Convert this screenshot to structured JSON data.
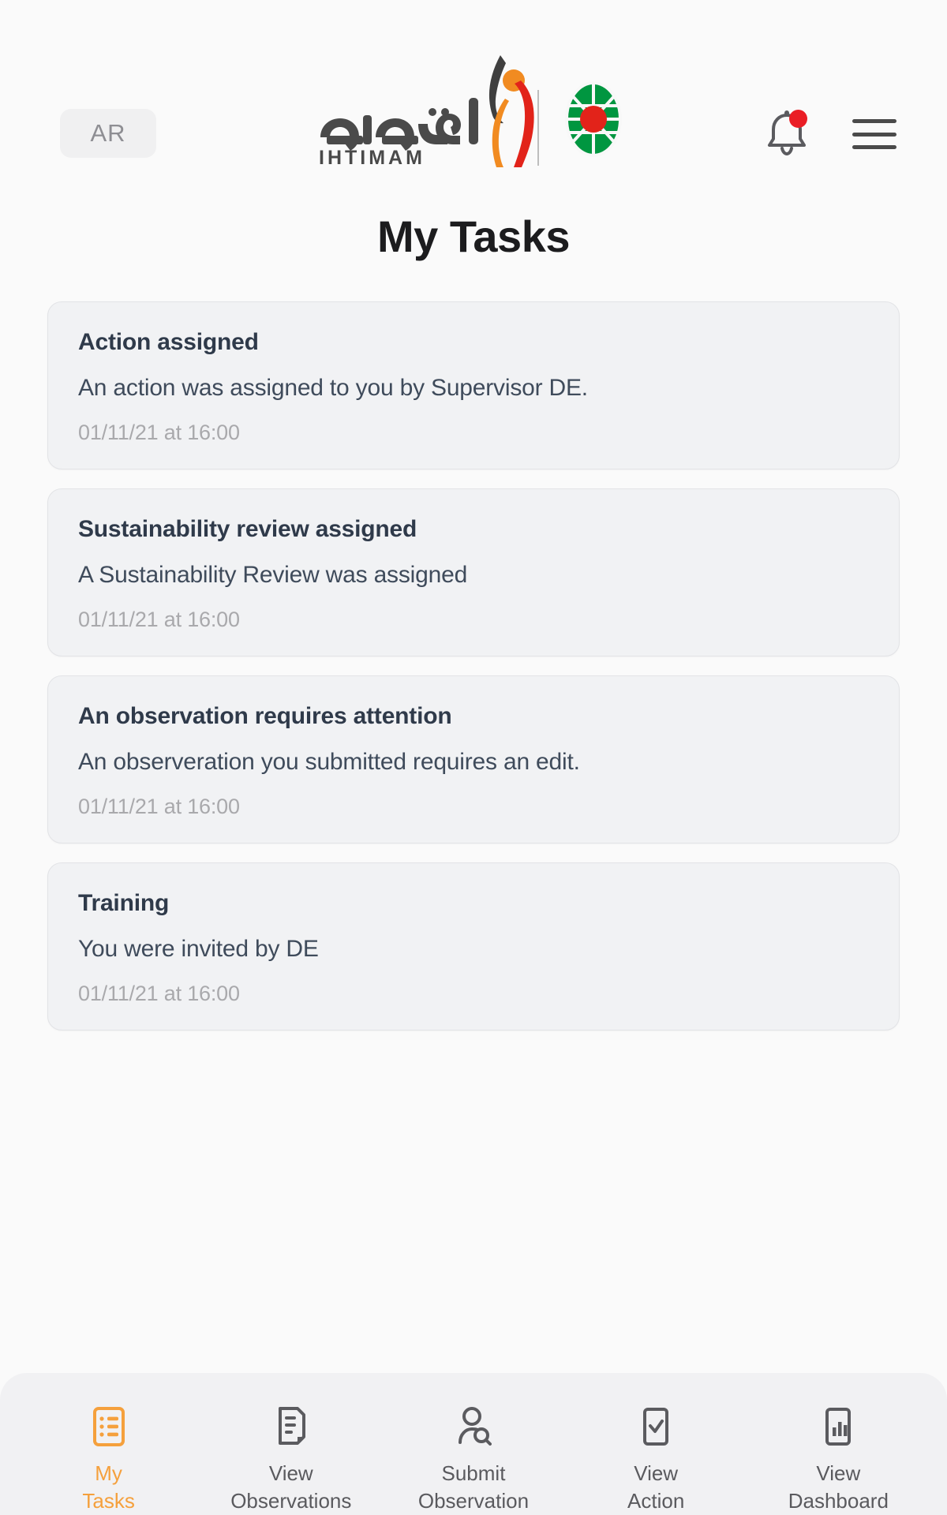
{
  "header": {
    "language_toggle": "AR",
    "logo_arabic": "اهتمام",
    "logo_latin": "IHTIMAM",
    "notification_icon": "bell-icon",
    "notification_badge": true,
    "menu_icon": "hamburger-menu-icon",
    "accent_orange": "#F5A03C",
    "accent_red": "#EA1D25",
    "accent_green": "#009640"
  },
  "page": {
    "title": "My Tasks"
  },
  "tasks": [
    {
      "title": "Action assigned",
      "body": "An action was assigned to you by Supervisor DE.",
      "time": "01/11/21 at 16:00"
    },
    {
      "title": "Sustainability review assigned",
      "body": "A Sustainability Review was assigned",
      "time": "01/11/21 at 16:00"
    },
    {
      "title": "An observation requires attention",
      "body": "An observeration you submitted requires an edit.",
      "time": "01/11/21 at 16:00"
    },
    {
      "title": "Training",
      "body": "You were invited by DE",
      "time": "01/11/21 at 16:00"
    }
  ],
  "bottom_nav": {
    "items": [
      {
        "line1": "My",
        "line2": "Tasks",
        "icon": "checklist-icon",
        "active": true
      },
      {
        "line1": "View",
        "line2": "Observations",
        "icon": "document-list-icon",
        "active": false
      },
      {
        "line1": "Submit",
        "line2": "Observation",
        "icon": "person-search-icon",
        "active": false
      },
      {
        "line1": "View",
        "line2": "Action",
        "icon": "checkbox-check-icon",
        "active": false
      },
      {
        "line1": "View",
        "line2": "Dashboard",
        "icon": "bar-chart-icon",
        "active": false
      }
    ]
  }
}
